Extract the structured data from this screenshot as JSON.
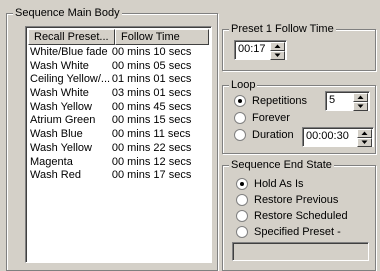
{
  "main_body": {
    "title": "Sequence Main Body",
    "columns": [
      "Recall Preset...",
      "Follow Time"
    ],
    "rows": [
      {
        "preset": "White/Blue fade",
        "time": "00 mins 10 secs"
      },
      {
        "preset": "Wash White",
        "time": "00 mins 05 secs"
      },
      {
        "preset": "Ceiling Yellow/...",
        "time": "01 mins 01 secs"
      },
      {
        "preset": "Wash White",
        "time": "03 mins 01 secs"
      },
      {
        "preset": "Wash Yellow",
        "time": "00 mins 45 secs"
      },
      {
        "preset": "Atrium Green",
        "time": "00 mins 15 secs"
      },
      {
        "preset": "Wash Blue",
        "time": "00 mins 11 secs"
      },
      {
        "preset": "Wash Yellow",
        "time": "00 mins 22 secs"
      },
      {
        "preset": "Magenta",
        "time": "00 mins 12 secs"
      },
      {
        "preset": "Wash Red",
        "time": "00 mins 17 secs"
      }
    ]
  },
  "follow_time": {
    "title": "Preset 1 Follow Time",
    "value": "00:17"
  },
  "loop": {
    "title": "Loop",
    "options": [
      "Repetitions",
      "Forever",
      "Duration"
    ],
    "selected": "Repetitions",
    "repetitions_value": "5",
    "duration_value": "00:00:30"
  },
  "end_state": {
    "title": "Sequence End State",
    "options": [
      "Hold As Is",
      "Restore Previous",
      "Restore Scheduled",
      "Specified Preset -"
    ],
    "selected": "Hold As Is",
    "preset_field": ""
  }
}
